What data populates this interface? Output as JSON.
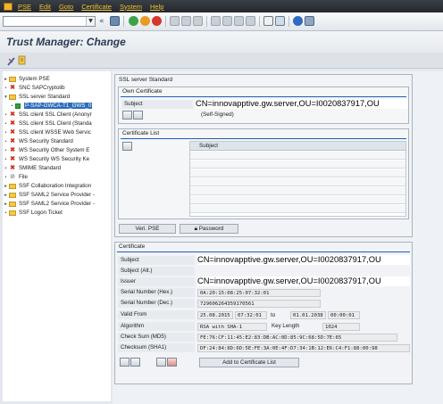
{
  "menubar": {
    "items": [
      "PSE",
      "Edit",
      "Goto",
      "Certificate",
      "System",
      "Help"
    ]
  },
  "colors": {
    "menu_text": "#f2c230",
    "accent_blue": "#1f5fb2",
    "selected": "#2d6dba"
  },
  "title": "Trust Manager: Change",
  "tree": {
    "items": [
      {
        "label": "System PSE",
        "icon": "folder-icon",
        "expand": "▸"
      },
      {
        "label": "SNC SAPCryptolib",
        "icon": "error-cross-icon",
        "expand": "•"
      },
      {
        "label": "SSL server Standard",
        "icon": "folder-icon",
        "expand": "▾"
      },
      {
        "label": "P-SAP-GWCA-T1_GWS_0",
        "icon": "green-status-icon",
        "expand": "•",
        "selected": true,
        "indent": 1
      },
      {
        "label": "SSL client SSL Client (Anonyr",
        "icon": "error-cross-icon",
        "expand": "•"
      },
      {
        "label": "SSL client SSL Client (Standa",
        "icon": "error-cross-icon",
        "expand": "•"
      },
      {
        "label": "SSL client WSSE Web Servic",
        "icon": "error-cross-icon",
        "expand": "•"
      },
      {
        "label": "WS Security Standard",
        "icon": "error-cross-icon",
        "expand": "•"
      },
      {
        "label": "WS Security Other System E",
        "icon": "error-cross-icon",
        "expand": "•"
      },
      {
        "label": "WS Security WS Security Ke",
        "icon": "error-cross-icon",
        "expand": "•"
      },
      {
        "label": "SMIME Standard",
        "icon": "error-cross-icon",
        "expand": "•"
      },
      {
        "label": "File",
        "icon": "file-icon",
        "expand": "•"
      },
      {
        "label": "SSF Collaboration Integration",
        "icon": "folder-icon",
        "expand": "▸"
      },
      {
        "label": "SSF SAML2 Service Provider -",
        "icon": "folder-icon",
        "expand": "▸"
      },
      {
        "label": "SSF SAML2 Service Provider -",
        "icon": "folder-icon",
        "expand": "▸"
      },
      {
        "label": "SSF Logon Ticket",
        "icon": "folder-icon",
        "expand": "•"
      }
    ]
  },
  "ssl_server": {
    "title": "SSL server Standard",
    "own_certificate": {
      "title": "Own Certificate",
      "subject_label": "Subject",
      "subject_value": "CN=innovapptive.gw.server,OU=I0020837917,OU",
      "self_signed": "(Self-Signed)"
    },
    "certificate_list": {
      "title": "Certificate List",
      "column_subject": "Subject"
    },
    "buttons": {
      "veri_pse": "Veri. PSE",
      "password": "Password"
    }
  },
  "certificate": {
    "title": "Certificate",
    "subject_label": "Subject",
    "subject_value": "CN=innovapptive.gw.server,OU=I0020837917,OU",
    "subject_alt_label": "Subject (Alt.)",
    "issuer_label": "Issuer",
    "issuer_value": "CN=innovapptive.gw.server,OU=I0020837917,OU",
    "serial_hex_label": "Serial Number (Hex.)",
    "serial_hex_value": "0A:20:15:08:25:07:32:01",
    "serial_dec_label": "Serial Number (Dec.)",
    "serial_dec_value": "729606264359170561",
    "valid_from_label": "Valid From",
    "valid_from_date": "25.08.2015",
    "valid_from_time": "07:32:01",
    "to_label": "to",
    "valid_to_date": "01.01.2038",
    "valid_to_time": "00:00:01",
    "algorithm_label": "Algorithm",
    "algorithm_value": "RSA with SHA-1",
    "key_length_label": "Key Length",
    "key_length_value": "1024",
    "md5_label": "Check Sum (MD5)",
    "md5_value": "FE:76:CF:11:45:E2:83:DB:AC:0D:85:9C:68:5D:7E:65",
    "sha1_label": "Checksum (SHA1)",
    "sha1_value": "DF:24:84:8D:6D:5E:FE:3A:0E:4F:D7:34:1B:12:E6:C4:F1:88:00:98",
    "add_button": "Add to Certificate List"
  }
}
